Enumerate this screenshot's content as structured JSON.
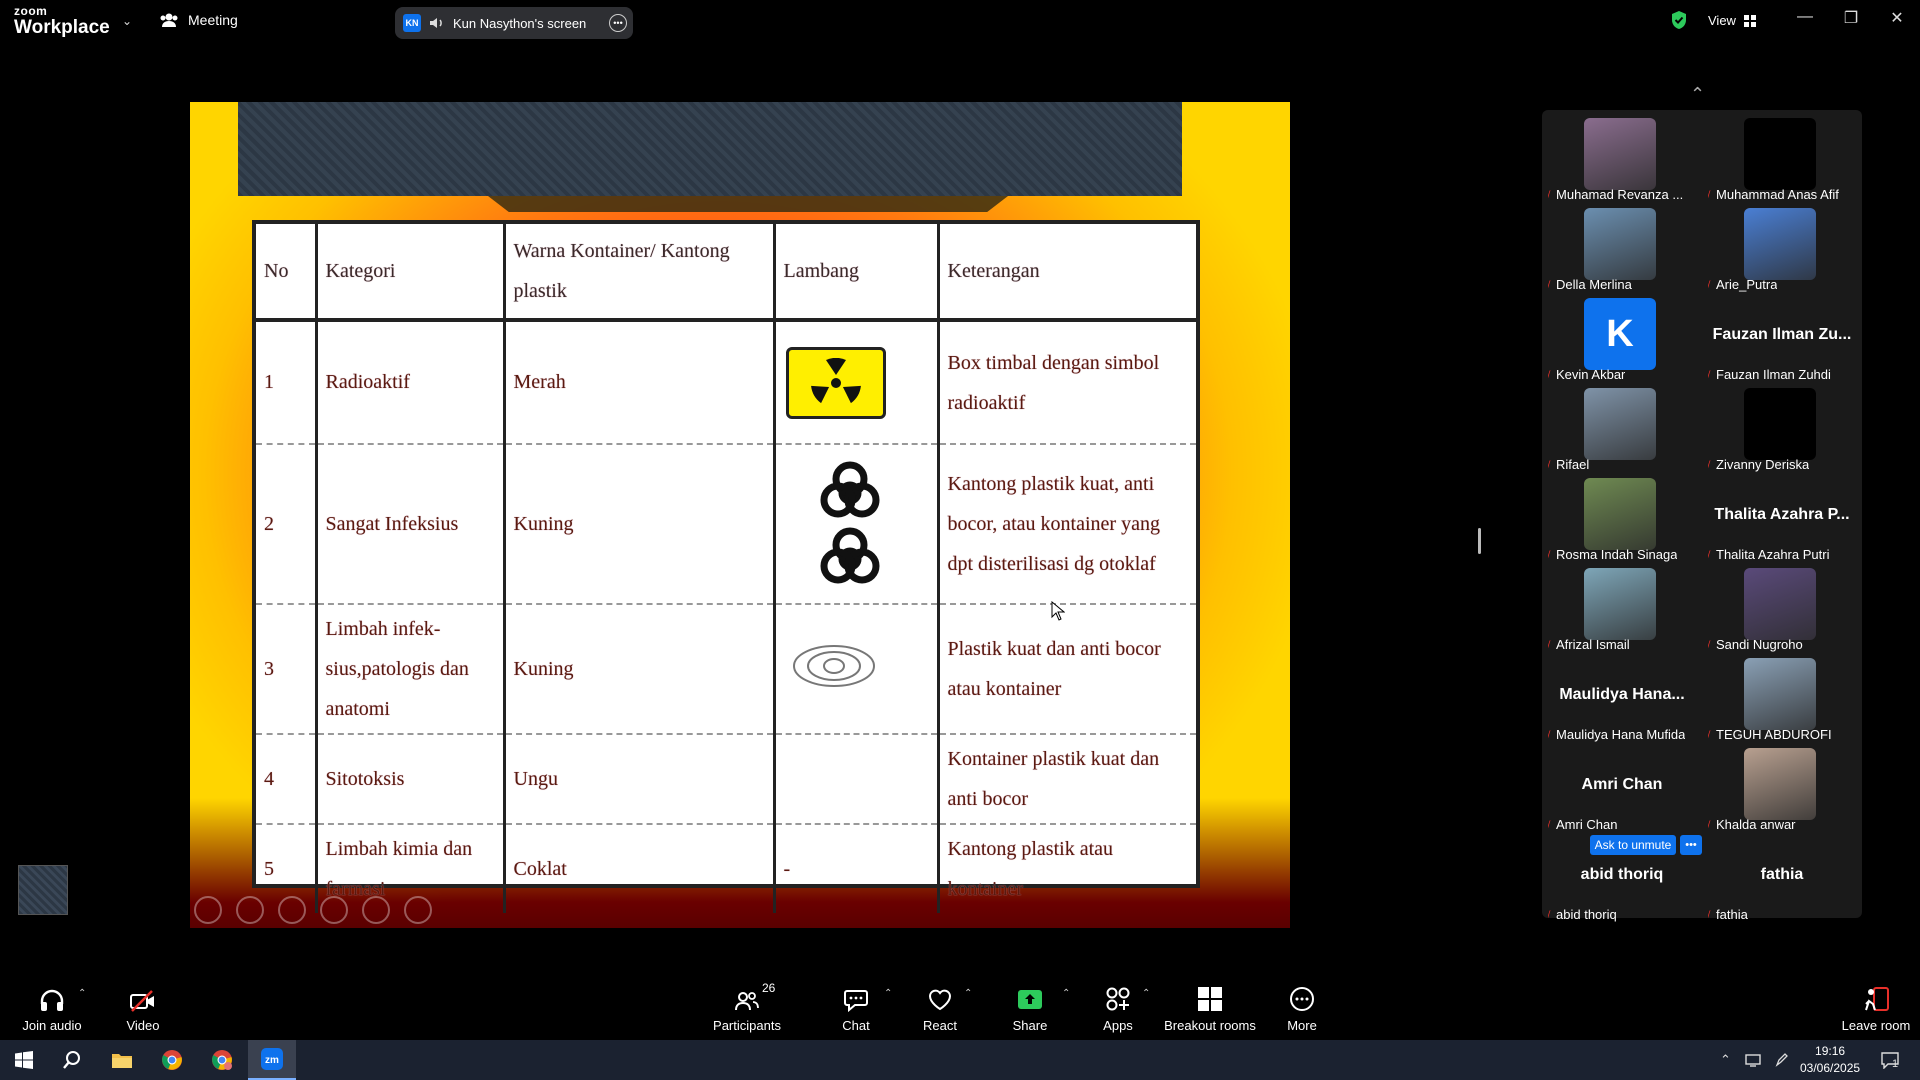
{
  "app": {
    "logo_line1": "zoom",
    "logo_line2": "Workplace",
    "meeting_label": "Meeting",
    "screen_share_initials": "KN",
    "screen_share_label": "Kun Nasython's screen",
    "view_label": "View"
  },
  "slide": {
    "headers": [
      "No",
      "Kategori",
      "Warna Kontainer/ Kantong plastik",
      "Lambang",
      "Keterangan"
    ],
    "rows": [
      {
        "no": "1",
        "kategori": "Radioaktif",
        "warna": "Merah",
        "lambang": "radioactive-icon",
        "ket": "Box timbal dengan simbol radioaktif"
      },
      {
        "no": "2",
        "kategori": "Sangat Infeksius",
        "warna": "Kuning",
        "lambang": "biohazard-icon",
        "ket": "Kantong plastik kuat, anti bocor, atau kontainer yang dpt disterilisasi dg otoklaf"
      },
      {
        "no": "3",
        "kategori": "Limbah infek-sius,patologis dan anatomi",
        "warna": "Kuning",
        "lambang": "biohazard-outline-icon",
        "ket": "Plastik kuat dan anti bocor atau kontainer"
      },
      {
        "no": "4",
        "kategori": "Sitotoksis",
        "warna": "Ungu",
        "lambang": "",
        "ket": "Kontainer plastik kuat dan anti bocor"
      },
      {
        "no": "5",
        "kategori": "Limbah kimia dan farmasi",
        "warna": "Coklat",
        "lambang": "-",
        "ket": "Kantong plastik atau kontainer"
      }
    ]
  },
  "gallery": {
    "participants": [
      {
        "name": "Muhamad Revanza ...",
        "display": "",
        "tile": "video",
        "color": "#8a6d8e"
      },
      {
        "name": "Muhammad Anas Afif",
        "display": "",
        "tile": "video",
        "color": "#000000"
      },
      {
        "name": "Della Merlina",
        "display": "",
        "tile": "video",
        "color": "#6b8fb0"
      },
      {
        "name": "Arie_Putra",
        "display": "",
        "tile": "video",
        "color": "#4a7fd4"
      },
      {
        "name": "Kevin Akbar",
        "display": "K",
        "tile": "avatar",
        "color": "#0e72ed"
      },
      {
        "name": "Fauzan Ilman Zuhdi",
        "display": "Fauzan Ilman Zu...",
        "tile": "text",
        "color": "#1a1a1a"
      },
      {
        "name": "Rifael",
        "display": "",
        "tile": "video",
        "color": "#7f93a8"
      },
      {
        "name": "Zivanny Deriska",
        "display": "",
        "tile": "video",
        "color": "#000000"
      },
      {
        "name": "Rosma Indah Sinaga",
        "display": "",
        "tile": "video",
        "color": "#6f8a52"
      },
      {
        "name": "Thalita Azahra Putri",
        "display": "Thalita Azahra P...",
        "tile": "text",
        "color": "#1a1a1a"
      },
      {
        "name": "Afrizal Ismail",
        "display": "",
        "tile": "video",
        "color": "#7ea6b8"
      },
      {
        "name": "Sandi Nugroho",
        "display": "",
        "tile": "video",
        "color": "#5a4a7a"
      },
      {
        "name": "Maulidya Hana Mufida",
        "display": "Maulidya Hana...",
        "tile": "text",
        "color": "#1a1a1a"
      },
      {
        "name": "TEGUH ABDUROFI",
        "display": "",
        "tile": "video",
        "color": "#8aa0b5"
      },
      {
        "name": "Amri Chan",
        "display": "Amri Chan",
        "tile": "text",
        "color": "#1a1a1a"
      },
      {
        "name": "Khalda anwar",
        "display": "",
        "tile": "video",
        "color": "#b8a090"
      },
      {
        "name": "abid thoriq",
        "display": "abid thoriq",
        "tile": "text",
        "color": "#1a1a1a"
      },
      {
        "name": "fathia",
        "display": "fathia",
        "tile": "text",
        "color": "#1a1a1a"
      }
    ],
    "ask_to_unmute": "Ask to unmute"
  },
  "toolbar": {
    "join_audio": "Join audio",
    "video": "Video",
    "participants": "Participants",
    "participants_count": "26",
    "chat": "Chat",
    "react": "React",
    "share": "Share",
    "apps": "Apps",
    "breakout": "Breakout rooms",
    "more": "More",
    "leave": "Leave room"
  },
  "taskbar": {
    "time": "19:16",
    "date": "03/06/2025",
    "notification_count": "1"
  },
  "colors": {
    "accent": "#0e72ed",
    "share_green": "#2dca5c",
    "muted_red": "#e8302a"
  }
}
